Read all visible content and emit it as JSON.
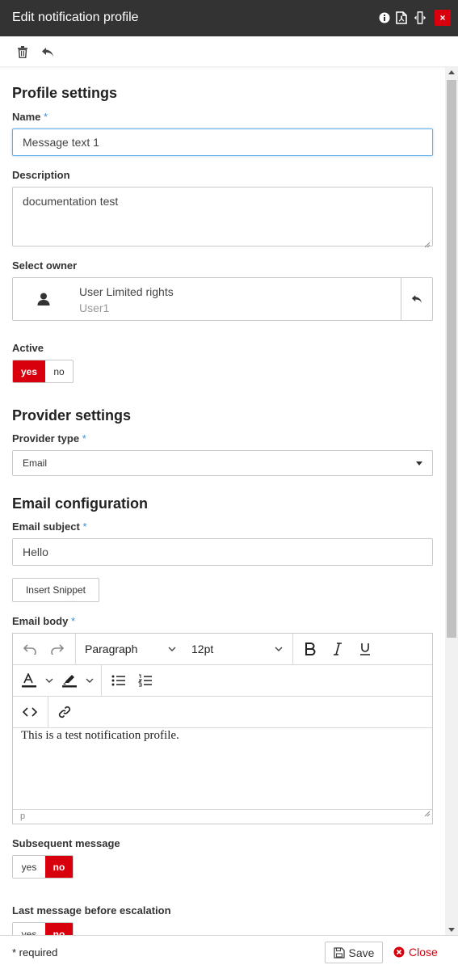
{
  "window": {
    "title": "Edit notification profile",
    "close_label": "×"
  },
  "profile": {
    "heading": "Profile settings",
    "name_label": "Name",
    "name_value": "Message text 1",
    "description_label": "Description",
    "description_value": "documentation test",
    "owner_label": "Select owner",
    "owner_name": "User Limited rights",
    "owner_login": "User1",
    "active_label": "Active",
    "active_yes": "yes",
    "active_no": "no"
  },
  "provider": {
    "heading": "Provider settings",
    "type_label": "Provider type",
    "type_value": "Email"
  },
  "email": {
    "heading": "Email configuration",
    "subject_label": "Email subject",
    "subject_value": "Hello",
    "insert_snippet_label": "Insert Snippet",
    "body_label": "Email body",
    "block_format": "Paragraph",
    "font_size": "12pt",
    "body_text": "This is a test notification profile.",
    "status_path": "p"
  },
  "subsequent": {
    "label": "Subsequent message",
    "yes": "yes",
    "no": "no"
  },
  "last_message": {
    "label": "Last message before escalation",
    "yes": "yes",
    "no": "no"
  },
  "required_marker": "*",
  "footer": {
    "required_note": "* required",
    "save_label": "Save",
    "close_label": "Close"
  },
  "colors": {
    "accent_red": "#d9000d",
    "titlebar": "#333333",
    "required_blue": "#3b8fd6"
  }
}
